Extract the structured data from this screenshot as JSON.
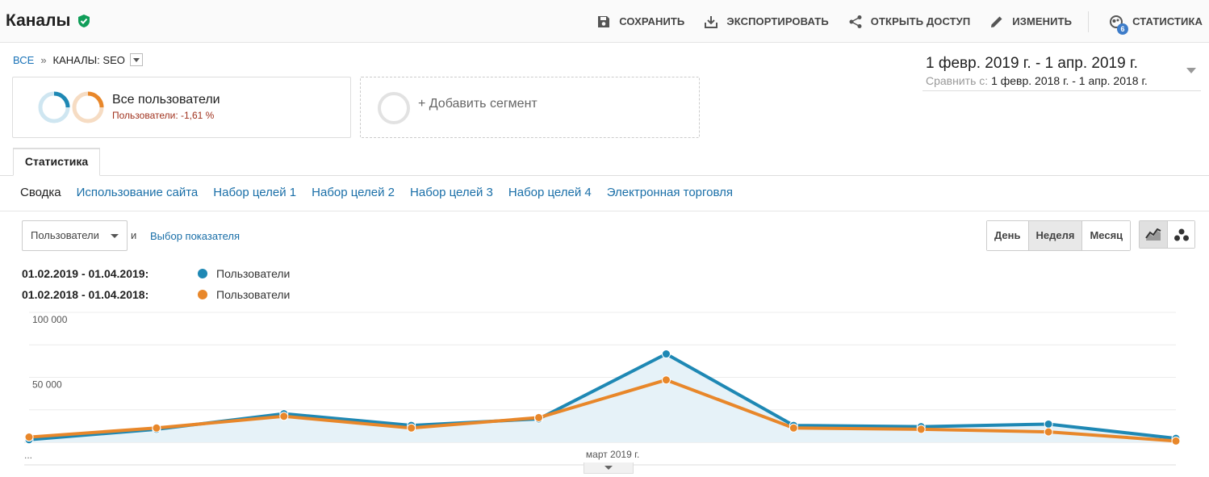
{
  "header": {
    "title": "Каналы",
    "actions": {
      "save": "СОХРАНИТЬ",
      "export": "ЭКСПОРТИРОВАТЬ",
      "share": "ОТКРЫТЬ ДОСТУП",
      "edit": "ИЗМЕНИТЬ",
      "insights": "СТАТИСТИКА",
      "insights_badge": "6"
    }
  },
  "breadcrumb": {
    "all": "ВСЕ",
    "separator": "»",
    "current": "КАНАЛЫ: SEO"
  },
  "daterange": {
    "main": "1 февр. 2019 г. - 1 апр. 2019 г.",
    "compare_label": "Сравнить с:",
    "compare_value": "1 февр. 2018 г. - 1 апр. 2018 г."
  },
  "segment": {
    "name": "Все пользователи",
    "sub": "Пользователи: -1,61 %"
  },
  "add_segment": "+ Добавить сегмент",
  "tab_active": "Статистика",
  "subnav": [
    "Сводка",
    "Использование сайта",
    "Набор целей 1",
    "Набор целей 2",
    "Набор целей 3",
    "Набор целей 4",
    "Электронная торговля"
  ],
  "metric_controls": {
    "metric": "Пользователи",
    "and": "и",
    "choose": "Выбор показателя"
  },
  "periods": [
    "День",
    "Неделя",
    "Месяц"
  ],
  "active_period": "Неделя",
  "legend": [
    {
      "date": "01.02.2019 - 01.04.2019:",
      "label": "Пользователи",
      "color": "#1e88b4"
    },
    {
      "date": "01.02.2018 - 01.04.2018:",
      "label": "Пользователи",
      "color": "#e8872a"
    }
  ],
  "colors": {
    "accent": "#1a73b8",
    "current_series": "#1e88b4",
    "previous_series": "#e8872a",
    "verified": "#0f9d58",
    "negative": "#a0321e"
  },
  "chart_data": {
    "type": "line",
    "ylim": [
      0,
      100000
    ],
    "y_ticks": [
      "100 000",
      "50 000"
    ],
    "x_tick_labels": [
      "...",
      "март 2019 г."
    ],
    "grid": true,
    "legend_position": "top-left",
    "series": [
      {
        "name": "01.02.2019 - 01.04.2019: Пользователи",
        "values": [
          2000,
          10000,
          22000,
          13000,
          18000,
          68000,
          13000,
          12000,
          14000,
          3000
        ]
      },
      {
        "name": "01.02.2018 - 01.04.2018: Пользователи",
        "values": [
          4000,
          11000,
          20000,
          11000,
          19000,
          48000,
          11000,
          10000,
          8000,
          1000
        ]
      }
    ]
  }
}
